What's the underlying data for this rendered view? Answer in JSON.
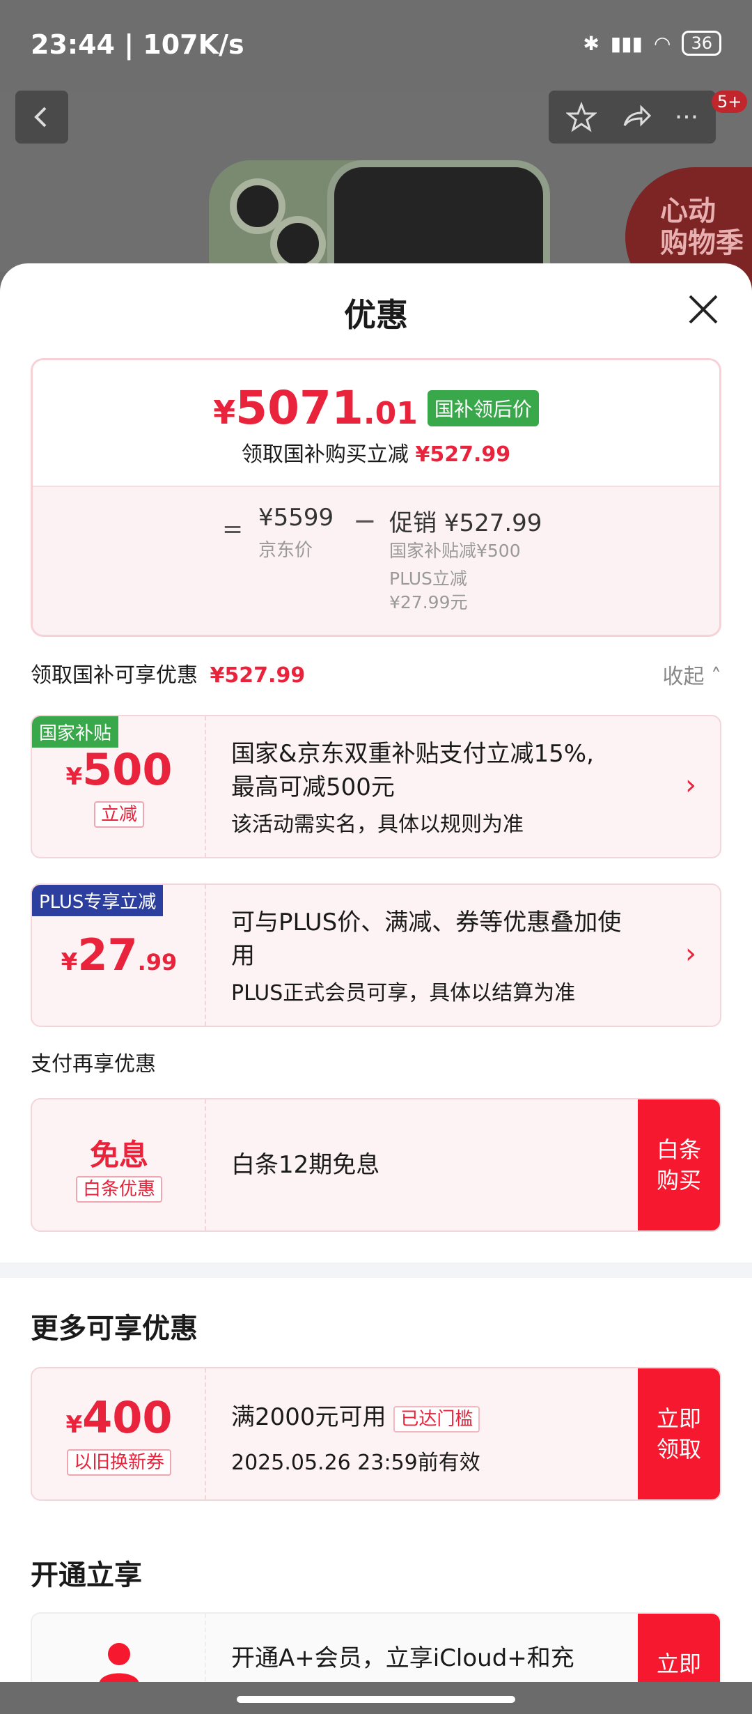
{
  "status_bar": {
    "time": "23:44 | 107K/s",
    "battery": "36",
    "icons": [
      "bluetooth-icon",
      "signal-icon",
      "wifi-icon",
      "battery-icon"
    ]
  },
  "header": {
    "badge": "5+",
    "promo": "心动\n购物季",
    "icons": [
      "back-icon",
      "star-icon",
      "share-icon",
      "more-icon"
    ]
  },
  "sheet": {
    "title": "优惠",
    "price_box": {
      "yen": "¥",
      "price_int": "5071",
      "price_dec": ".01",
      "tag": "国补领后价",
      "subline_text": "领取国补购买立减",
      "subline_amount": "¥527.99",
      "eq": "=",
      "jd_price": "¥5599",
      "jd_label": "京东价",
      "minus": "−",
      "promo_line": "促销 ¥527.99",
      "promo_detail_1": "国家补贴减¥500",
      "promo_detail_2": "PLUS立减",
      "promo_detail_3": "¥27.99元"
    },
    "claim_row": {
      "text": "领取国补可享优惠",
      "amount": "¥527.99",
      "collapse": "收起"
    },
    "coupons": [
      {
        "corner": "国家补贴",
        "corner_color": "#38a84a",
        "yen": "¥",
        "amount": "500",
        "decimal": "",
        "sub": "立减",
        "line1": "国家&京东双重补贴支付立减15%,",
        "line2": "最高可减500元",
        "small": "该活动需实名，具体以规则为准"
      },
      {
        "corner": "PLUS专享立减",
        "corner_color": "#2c3f9e",
        "yen": "¥",
        "amount": "27",
        "decimal": ".99",
        "sub": "",
        "line1": "可与PLUS价、满减、券等优惠叠加使",
        "line2": "用",
        "small": "PLUS正式会员可享，具体以结算为准"
      }
    ],
    "pay_section": {
      "heading": "支付再享优惠",
      "title": "免息",
      "sub": "白条优惠",
      "text": "白条12期免息",
      "button": "白条\n购买"
    },
    "more_section": {
      "heading": "更多可享优惠",
      "yen": "¥",
      "amount": "400",
      "sub": "以旧换新券",
      "line1": "满2000元可用",
      "tag": "已达门槛",
      "line2": "2025.05.26 23:59前有效",
      "button": "立即\n领取"
    },
    "open_section": {
      "heading": "开通立享",
      "text": "开通A+会员，立享iCloud+和充",
      "button": "立即"
    }
  }
}
